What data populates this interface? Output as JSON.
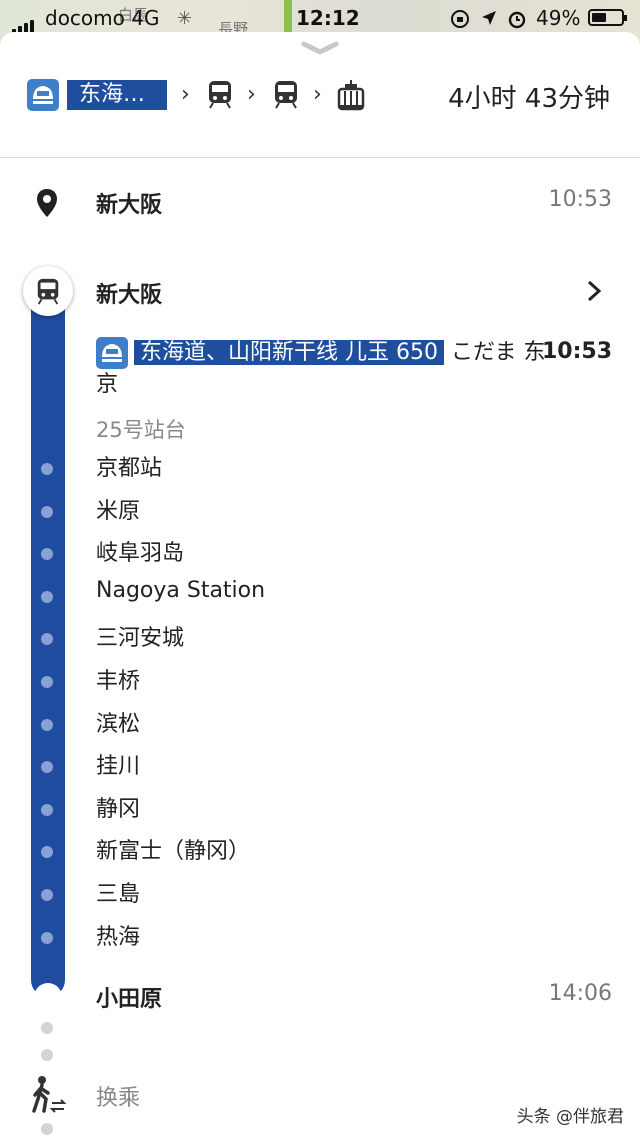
{
  "status": {
    "carrier": "docomo",
    "network": "4G",
    "time": "12:12",
    "battery_pct": "49%",
    "battery_level": 0.49
  },
  "map_labels": [
    "白馬",
    "長野"
  ],
  "route": {
    "first_label": "东海…",
    "duration": "4小时 43分钟",
    "icons": [
      "shinkansen-icon",
      "train-icon",
      "train-icon",
      "cable-car-icon"
    ]
  },
  "start": {
    "name": "新大阪",
    "time": "10:53"
  },
  "segment": {
    "station": "新大阪",
    "train_highlight": "东海道、山阳新干线 儿玉 650",
    "train_rest": " こだま 东京",
    "train_time": "10:53",
    "platform": "25号站台",
    "stops": [
      "京都站",
      "米原",
      "岐阜羽岛",
      "Nagoya Station",
      "三河安城",
      "丰桥",
      "滨松",
      "挂川",
      "静冈",
      "新富士（静冈）",
      "三島",
      "热海"
    ],
    "end_station": "小田原",
    "end_time": "14:06"
  },
  "transfer": {
    "label": "换乘"
  },
  "watermark": "头条 @伴旅君",
  "colors": {
    "line": "#1f4ba0",
    "highlight": "#1f4e9e",
    "badge": "#3f7fc9"
  }
}
